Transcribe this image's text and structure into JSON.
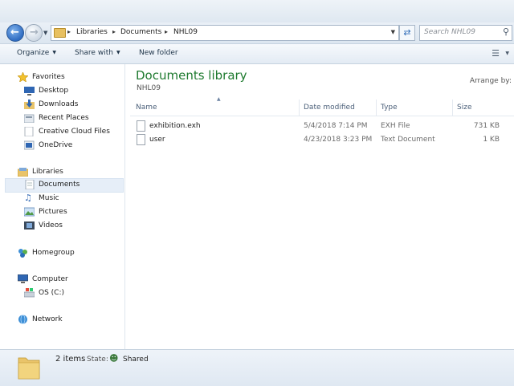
{
  "window": {
    "title": "NHL09 window title (address bar)"
  },
  "address": {
    "crumbs": [
      "Libraries",
      "Documents",
      "NHL09"
    ],
    "search_placeholder": "Search NHL09"
  },
  "toolbar": {
    "organize": "Organize",
    "share_with": "Share with",
    "new_folder": "New folder"
  },
  "nav": {
    "favorites": {
      "label": "Favorites",
      "items": [
        {
          "label": "Desktop",
          "icon": "desktop-icon"
        },
        {
          "label": "Downloads",
          "icon": "downloads-icon"
        },
        {
          "label": "Recent Places",
          "icon": "recent-places-icon"
        },
        {
          "label": "Creative Cloud Files",
          "icon": "creative-cloud-icon"
        },
        {
          "label": "OneDrive",
          "icon": "onedrive-icon"
        }
      ]
    },
    "libraries": {
      "label": "Libraries",
      "items": [
        {
          "label": "Documents",
          "icon": "documents-icon",
          "selected": true
        },
        {
          "label": "Music",
          "icon": "music-icon"
        },
        {
          "label": "Pictures",
          "icon": "pictures-icon"
        },
        {
          "label": "Videos",
          "icon": "videos-icon"
        }
      ]
    },
    "homegroup": "Homegroup",
    "computer": {
      "label": "Computer",
      "items": [
        {
          "label": "OS (C:)",
          "icon": "drive-icon"
        }
      ]
    },
    "network": "Network"
  },
  "library": {
    "title": "Documents library",
    "subtitle": "NHL09",
    "arrange_by": "Arrange by:"
  },
  "columns": [
    "Name",
    "Date modified",
    "Type",
    "Size"
  ],
  "files": [
    {
      "name": "exhibition.exh",
      "date": "5/4/2018 7:14 PM",
      "type": "EXH File",
      "size": "731 KB"
    },
    {
      "name": "user",
      "date": "4/23/2018 3:23 PM",
      "type": "Text Document",
      "size": "1 KB"
    }
  ],
  "status": {
    "item_count": "2 items",
    "state_label": "State:",
    "state_value": "Shared"
  },
  "colors": {
    "library_title": "#1e7a2f",
    "selection": "#e6eef8",
    "chrome": "#dfe8f1"
  }
}
